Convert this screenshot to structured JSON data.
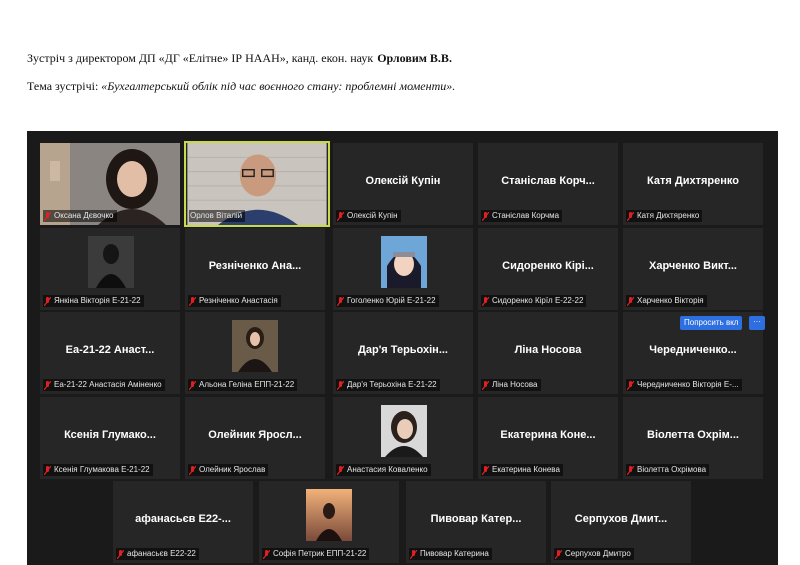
{
  "document": {
    "line1_prefix": "Зустріч з директором ДП «ДГ «Елітне» ІР НААН», канд. екон. наук",
    "line1_name": "Орловим В.В.",
    "line2_prefix": "Тема зустрічі: ",
    "line2_topic": "«Бухгалтерський облік під час воєнного стану: проблемні моменти»."
  },
  "meeting": {
    "ask_button": "Попросить вкл",
    "more_button": "···",
    "muted_icon": "mic-muted-icon",
    "active_border_color": "#c8d94a",
    "participants": [
      {
        "display": "",
        "label": "Оксана Дєвочко",
        "photo": "woman-photo"
      },
      {
        "display": "",
        "label": "Орлов Віталій",
        "photo": "man-glasses-photo",
        "active": true
      },
      {
        "display": "Олексій Купін",
        "label": "Олексій Купін"
      },
      {
        "display": "Станіслав Корч...",
        "label": "Станіслав Корчма"
      },
      {
        "display": "Катя Дихтяренко",
        "label": "Катя Дихтяренко"
      },
      {
        "display": "",
        "label": "Янкіна Вікторія Е-21-22",
        "photo": "avatar-photo"
      },
      {
        "display": "Резніченко Ана...",
        "label": "Резніченко Анастасія"
      },
      {
        "display": "",
        "label": "Гоголенко Юрій Е-21-22",
        "photo": "anime-avatar"
      },
      {
        "display": "Сидоренко Кірі...",
        "label": "Сидоренко Кірїл Е-22-22"
      },
      {
        "display": "Харченко Викт...",
        "label": "Харченко Вікторія"
      },
      {
        "display": "Еа-21-22 Анаст...",
        "label": "Еа-21-22 Анастасія Аміненко"
      },
      {
        "display": "",
        "label": "Альона Геліна ЕПП-21-22",
        "photo": "avatar-photo"
      },
      {
        "display": "Дар'я Терьохін...",
        "label": "Дар'я Терьохіна Е-21-22"
      },
      {
        "display": "Ліна Носова",
        "label": "Ліна Носова"
      },
      {
        "display": "Чередниченко...",
        "label": "Чередниченко Вікторія Е-..."
      },
      {
        "display": "Ксенія Глумако...",
        "label": "Ксенія Глумакова Е-21-22"
      },
      {
        "display": "Олейник Яросл...",
        "label": "Олейник Ярослав"
      },
      {
        "display": "",
        "label": "Анастасия Коваленко",
        "photo": "avatar-photo"
      },
      {
        "display": "Екатерина Коне...",
        "label": "Екатерина Конева"
      },
      {
        "display": "Віолетта Охрім...",
        "label": "Віолетта Охрімова"
      },
      {
        "display": "афанасьєв Е22-...",
        "label": "афанасьєв Е22-22"
      },
      {
        "display": "",
        "label": "Софія Петрик ЕПП-21-22",
        "photo": "sunset-photo"
      },
      {
        "display": "Пивовар Катер...",
        "label": "Пивовар Катерина"
      },
      {
        "display": "Серпухов Дмит...",
        "label": "Серпухов Дмитро"
      }
    ]
  }
}
